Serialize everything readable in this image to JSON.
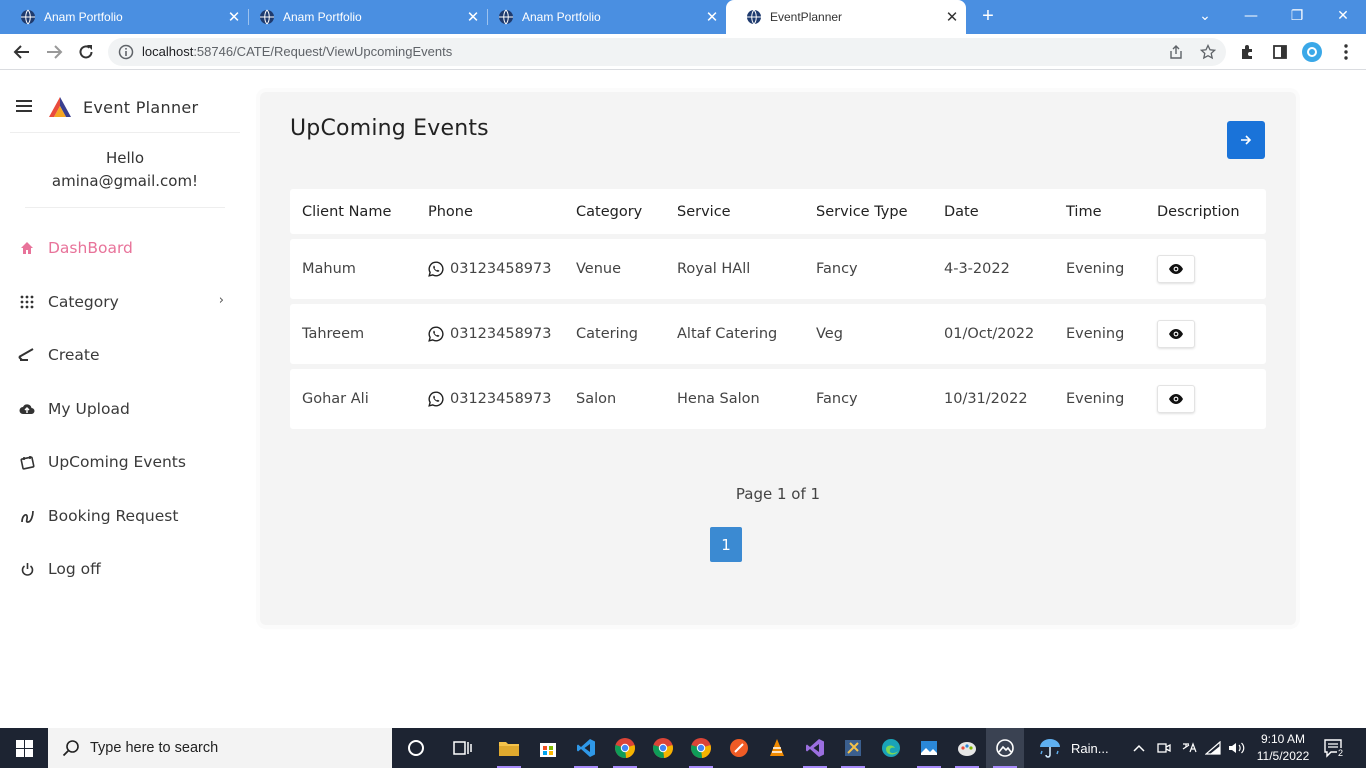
{
  "browser": {
    "tabs": [
      {
        "title": "Anam Portfolio",
        "active": false
      },
      {
        "title": "Anam Portfolio",
        "active": false
      },
      {
        "title": "Anam Portfolio",
        "active": false
      },
      {
        "title": "EventPlanner",
        "active": true
      }
    ],
    "url_host": "localhost",
    "url_path": ":58746/CATE/Request/ViewUpcomingEvents"
  },
  "sidebar": {
    "brand": "Event Planner",
    "greeting": "Hello",
    "user_email": "amina@gmail.com!",
    "items": [
      {
        "label": "DashBoard",
        "icon": "home-icon",
        "active": true
      },
      {
        "label": "Category",
        "icon": "grid-dots-icon",
        "has_submenu": true
      },
      {
        "label": "Create",
        "icon": "pen-icon"
      },
      {
        "label": "My Upload",
        "icon": "cloud-upload-icon"
      },
      {
        "label": "UpComing Events",
        "icon": "calendar-icon"
      },
      {
        "label": "Booking Request",
        "icon": "request-icon"
      },
      {
        "label": "Log off",
        "icon": "power-icon"
      }
    ]
  },
  "main": {
    "title": "UpComing Events",
    "columns": [
      "Client Name",
      "Phone",
      "Category",
      "Service",
      "Service Type",
      "Date",
      "Time",
      "Description"
    ],
    "rows": [
      {
        "client": "Mahum",
        "phone": "03123458973",
        "category": "Venue",
        "service": "Royal HAll",
        "service_type": "Fancy",
        "date": "4-3-2022",
        "time": "Evening"
      },
      {
        "client": "Tahreem",
        "phone": "03123458973",
        "category": "Catering",
        "service": "Altaf Catering",
        "service_type": "Veg",
        "date": "01/Oct/2022",
        "time": "Evening"
      },
      {
        "client": "Gohar Ali",
        "phone": "03123458973",
        "category": "Salon",
        "service": "Hena Salon",
        "service_type": "Fancy",
        "date": "10/31/2022",
        "time": "Evening"
      }
    ],
    "pager_text": "Page 1 of 1",
    "current_page": "1"
  },
  "taskbar": {
    "search_placeholder": "Type here to search",
    "weather": "Rain...",
    "time": "9:10 AM",
    "date": "11/5/2022",
    "notification_count": "2"
  },
  "colors": {
    "tab_bar": "#4a8fe1",
    "accent_pink": "#e8739a",
    "primary_blue": "#1a73d9",
    "pager_blue": "#3b8ad2",
    "taskbar": "#1d2432"
  }
}
